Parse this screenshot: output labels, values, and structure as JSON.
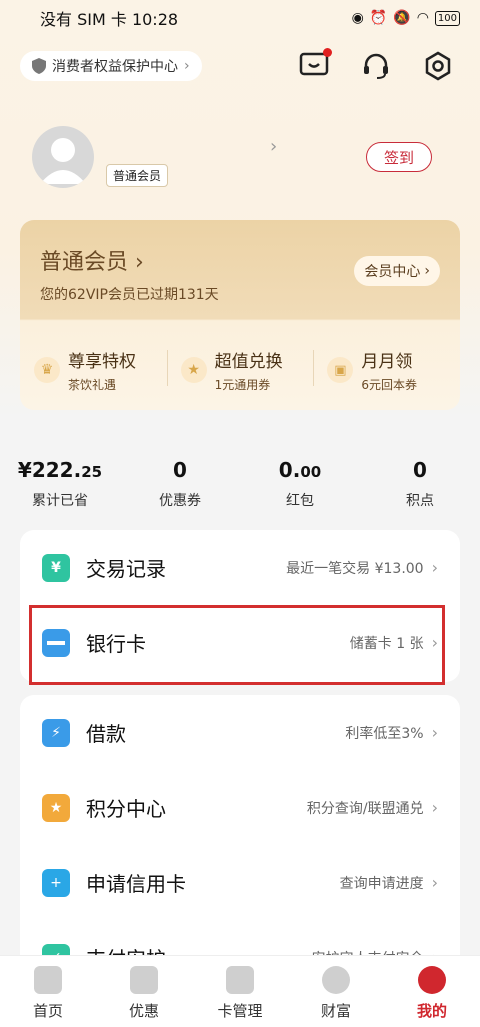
{
  "status_bar": {
    "left": "没有 SIM 卡 10:28",
    "battery": "100"
  },
  "header": {
    "consumer_center": "消费者权益保护中心"
  },
  "profile": {
    "member_tag": "普通会员",
    "signin_label": "签到"
  },
  "vip": {
    "title": "普通会员",
    "subtitle": "您的62VIP会员已过期131天",
    "center_button": "会员中心",
    "perks": [
      {
        "title": "尊享特权",
        "sub": "茶饮礼遇"
      },
      {
        "title": "超值兑换",
        "sub": "1元通用券"
      },
      {
        "title": "月月领",
        "sub": "6元回本券"
      }
    ]
  },
  "stats": {
    "saved": {
      "main": "¥222.",
      "small": "25",
      "label": "累计已省"
    },
    "coupons": {
      "value": "0",
      "label": "优惠券"
    },
    "redpack": {
      "main": "0.",
      "small": "00",
      "label": "红包"
    },
    "points": {
      "value": "0",
      "label": "积点"
    }
  },
  "card1": [
    {
      "title": "交易记录",
      "right": "最近一笔交易 ¥13.00"
    },
    {
      "title": "银行卡",
      "right": "储蓄卡 1 张"
    }
  ],
  "card2": [
    {
      "title": "借款",
      "right": "利率低至3%"
    },
    {
      "title": "积分中心",
      "right": "积分查询/联盟通兑"
    },
    {
      "title": "申请信用卡",
      "right": "查询申请进度"
    },
    {
      "title": "支付安护",
      "right": "安护守人支付安全"
    }
  ],
  "tabs": [
    "首页",
    "优惠",
    "卡管理",
    "财富",
    "我的"
  ],
  "colors": {
    "brand_red": "#d0272e",
    "gold_text": "#6a4a26"
  }
}
